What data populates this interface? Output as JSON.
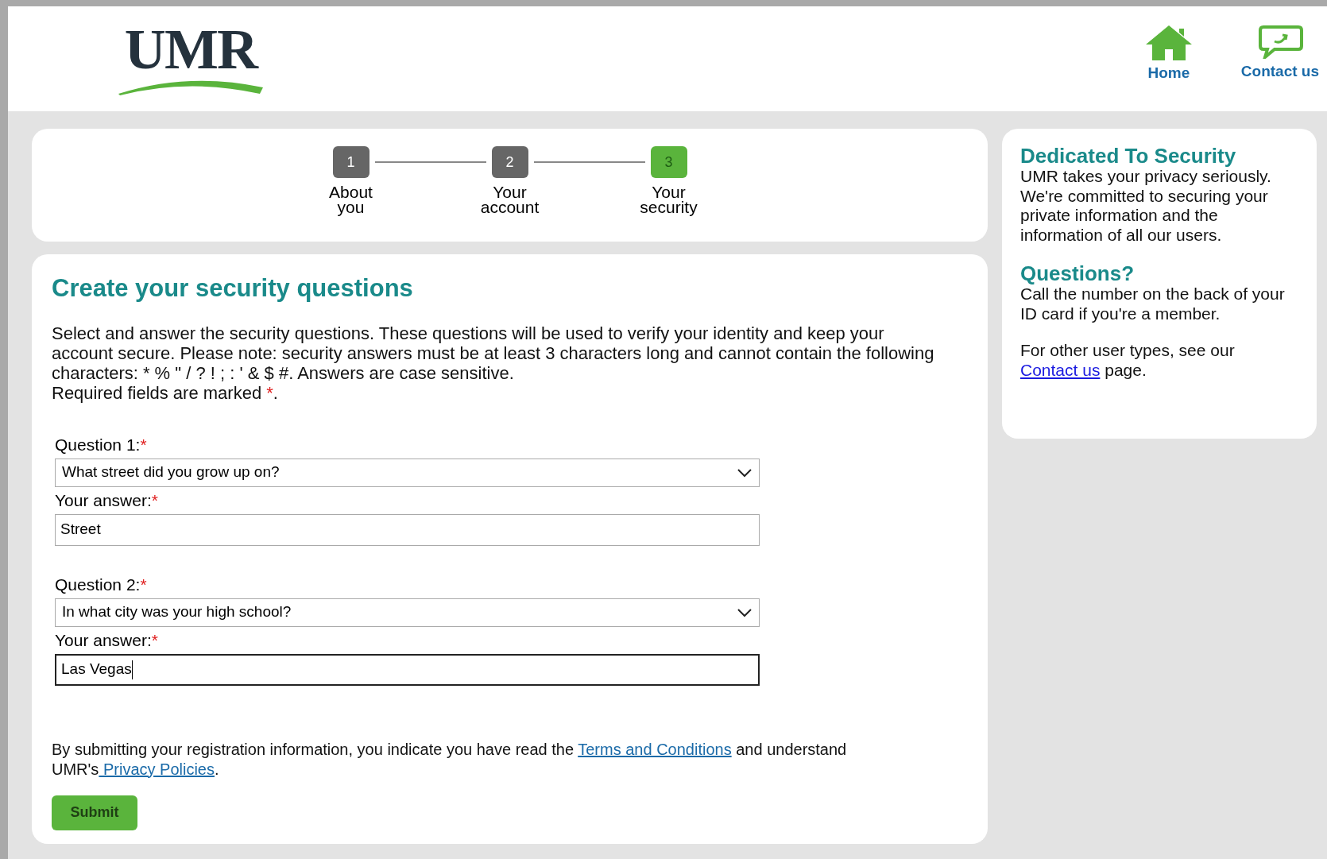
{
  "header": {
    "logo": "UMR",
    "nav": [
      {
        "kind": "home",
        "label": "Home"
      },
      {
        "kind": "contact",
        "label": "Contact us"
      }
    ]
  },
  "steps": [
    {
      "number": "1",
      "label": "About you",
      "selected": false
    },
    {
      "number": "2",
      "label": "Your account",
      "selected": false
    },
    {
      "number": "3",
      "label": "Your security",
      "selected": true
    }
  ],
  "form": {
    "title": "Create your security questions",
    "intro": "Select and answer the security questions. These questions will be used to verify your identity and keep your account secure. Please note: security answers must be at least 3 characters long and cannot contain the following characters: * % \" / ? ! ; : ' & $ #. Answers are case sensitive.",
    "required_note": {
      "text": "Required fields are marked ",
      "mark": "*",
      "end": "."
    },
    "questions": [
      {
        "label": "Question 1:",
        "mark": "*",
        "value": "What street did you grow up on?",
        "answer_label": "Your answer:",
        "answer_mark": "*",
        "answer": "Street",
        "focused": false
      },
      {
        "label": "Question 2:",
        "mark": "*",
        "value": "In what city was your high school?",
        "answer_label": "Your answer:",
        "answer_mark": "*",
        "answer": "Las Vegas",
        "focused": true
      }
    ],
    "terms": {
      "before": "By submitting your registration information, you indicate you have read the ",
      "link1": "Terms and Conditions",
      "middle": " and understand UMR's",
      "link2": " Privacy Policies",
      "after": "."
    },
    "submit": "Submit"
  },
  "sidebar": {
    "sections": [
      {
        "title": "Dedicated To Security",
        "text": "UMR takes your privacy seriously. We're committed to securing your private information and the information of all our users."
      },
      {
        "title": "Questions?",
        "text": "Call the number on the back of your ID card if you're a member."
      }
    ],
    "other": {
      "before": "For other user types, see our ",
      "link": "Contact us",
      "after": " page."
    }
  }
}
